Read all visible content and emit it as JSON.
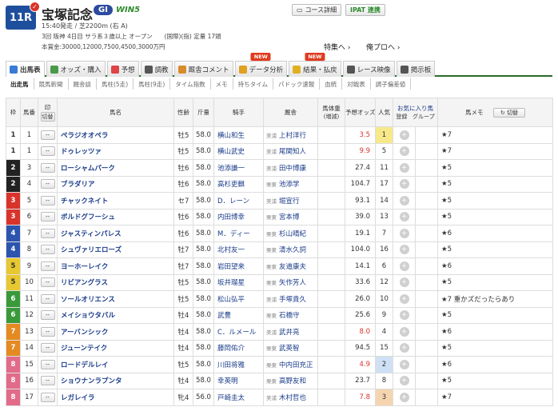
{
  "race": {
    "number": "11R",
    "name": "宝塚記念",
    "grade": "GI",
    "win5": "WIN5",
    "meta1": "15:40発走 / 芝2200m (右 A)",
    "meta2": "3回 阪神 4日目 サラ系３歳以上 オープン　　(国際)(指) 定量 17頭",
    "meta3": "本賞金:30000,12000,7500,4500,3000万円"
  },
  "header_buttons": {
    "course": "コース詳細",
    "ipat": "IPAT 連携"
  },
  "special_links": {
    "tokubetsu": "特集へ ›",
    "oreno": "俺プロへ ›"
  },
  "tabs": [
    {
      "label": "出馬表",
      "icon": "horse-icon",
      "color": "#3a7bd5",
      "new": ""
    },
    {
      "label": "オッズ・購入",
      "icon": "ticket-icon",
      "color": "#4a9a4a",
      "new": ""
    },
    {
      "label": "予想",
      "icon": "target-icon",
      "color": "#d44",
      "new": ""
    },
    {
      "label": "調教",
      "icon": "stopwatch-icon",
      "color": "#555",
      "new": ""
    },
    {
      "label": "厩舎コメント",
      "icon": "house-icon",
      "color": "#d88b2a",
      "new": ""
    },
    {
      "label": "データ分析",
      "icon": "chart-icon",
      "color": "#e0a020",
      "new": "NEW"
    },
    {
      "label": "結果・払戻",
      "icon": "trophy-icon",
      "color": "#e0b020",
      "new": "NEW"
    },
    {
      "label": "レース映像",
      "icon": "video-icon",
      "color": "#555",
      "new": ""
    },
    {
      "label": "掲示板",
      "icon": "board-icon",
      "color": "#555",
      "new": ""
    }
  ],
  "subtabs": [
    "出走馬",
    "競馬新聞",
    "厩舎談",
    "馬柱(5走)",
    "馬柱(9走)",
    "タイム指数",
    "メモ",
    "持ちタイム",
    "パドック速報",
    "血統",
    "対戦表",
    "調子偏差値"
  ],
  "columns": {
    "waku": "枠",
    "umaban": "馬番",
    "mark": "印",
    "mark_btn": "切替",
    "horse": "馬名",
    "sex_age": "性齢",
    "weight": "斤量",
    "jockey": "騎手",
    "trainer": "厩舎",
    "horse_weight": "馬体重",
    "horse_weight_sub": "(増減)",
    "odds": "予想オッズ",
    "popularity": "人気",
    "fav": "お気に入り馬",
    "fav_reg": "登録",
    "fav_group": "グループ",
    "memo": "馬メモ",
    "memo_btn": "切替"
  },
  "mark_placeholder": "--",
  "waku_colors": [
    "#ffffff",
    "#222222",
    "#d9342b",
    "#2c55b0",
    "#e8c830",
    "#3a9a3a",
    "#e58a20",
    "#e36b8a"
  ],
  "rows": [
    {
      "waku": 1,
      "num": "1",
      "name": "ペラジオオペラ",
      "sa": "牡5",
      "w": "58.0",
      "jockey": "横山和生",
      "area": "美浦",
      "trainer": "上村洋行",
      "odds": "3.5",
      "oddsHot": true,
      "pop": "1",
      "popColor": "#f7e88a",
      "memo": "★7"
    },
    {
      "waku": 1,
      "num": "1",
      "name": "ドゥレッツァ",
      "sa": "牡5",
      "w": "58.0",
      "jockey": "横山武史",
      "area": "美浦",
      "trainer": "尾関知人",
      "odds": "9.9",
      "oddsHot": true,
      "pop": "5",
      "popColor": "",
      "memo": "★7"
    },
    {
      "waku": 2,
      "num": "3",
      "name": "ローシャムパーク",
      "sa": "牡6",
      "w": "58.0",
      "jockey": "池添謙一",
      "area": "美浦",
      "trainer": "田中博康",
      "odds": "27.4",
      "oddsHot": false,
      "pop": "11",
      "popColor": "",
      "memo": "★5"
    },
    {
      "waku": 2,
      "num": "4",
      "name": "ブラダリア",
      "sa": "牡6",
      "w": "58.0",
      "jockey": "高杉吏麒",
      "area": "栗東",
      "trainer": "池添学",
      "odds": "104.7",
      "oddsHot": false,
      "pop": "17",
      "popColor": "",
      "memo": "★5"
    },
    {
      "waku": 3,
      "num": "5",
      "name": "チャックネイト",
      "sa": "セ7",
      "w": "58.0",
      "jockey": "D．レーン",
      "area": "美浦",
      "trainer": "堀宣行",
      "odds": "93.1",
      "oddsHot": false,
      "pop": "14",
      "popColor": "",
      "memo": "★5"
    },
    {
      "waku": 3,
      "num": "6",
      "name": "ボルドグフーシュ",
      "sa": "牡6",
      "w": "58.0",
      "jockey": "内田博幸",
      "area": "栗東",
      "trainer": "宮本博",
      "odds": "39.0",
      "oddsHot": false,
      "pop": "13",
      "popColor": "",
      "memo": "★5"
    },
    {
      "waku": 4,
      "num": "7",
      "name": "ジャスティンパレス",
      "sa": "牡6",
      "w": "58.0",
      "jockey": "M．ディー",
      "area": "栗東",
      "trainer": "杉山晴紀",
      "odds": "19.1",
      "oddsHot": false,
      "pop": "7",
      "popColor": "",
      "memo": "★6"
    },
    {
      "waku": 4,
      "num": "8",
      "name": "シュヴァリエローズ",
      "sa": "牡7",
      "w": "58.0",
      "jockey": "北村友一",
      "area": "栗東",
      "trainer": "清水久詞",
      "odds": "104.0",
      "oddsHot": false,
      "pop": "16",
      "popColor": "",
      "memo": "★5"
    },
    {
      "waku": 5,
      "num": "9",
      "name": "ヨーホーレイク",
      "sa": "牡7",
      "w": "58.0",
      "jockey": "岩田望来",
      "area": "栗東",
      "trainer": "友道康夫",
      "odds": "14.1",
      "oddsHot": false,
      "pop": "6",
      "popColor": "",
      "memo": "★6"
    },
    {
      "waku": 5,
      "num": "10",
      "name": "リビアングラス",
      "sa": "牡5",
      "w": "58.0",
      "jockey": "坂井瑠星",
      "area": "栗東",
      "trainer": "矢作芳人",
      "odds": "33.6",
      "oddsHot": false,
      "pop": "12",
      "popColor": "",
      "memo": "★5"
    },
    {
      "waku": 6,
      "num": "11",
      "name": "ソールオリエンス",
      "sa": "牡5",
      "w": "58.0",
      "jockey": "松山弘平",
      "area": "美浦",
      "trainer": "手塚貴久",
      "odds": "26.0",
      "oddsHot": false,
      "pop": "10",
      "popColor": "",
      "memo": "★7 重かズだったらあり"
    },
    {
      "waku": 6,
      "num": "12",
      "name": "メイショウタバル",
      "sa": "牡4",
      "w": "58.0",
      "jockey": "武豊",
      "area": "栗東",
      "trainer": "石橋守",
      "odds": "25.6",
      "oddsHot": false,
      "pop": "9",
      "popColor": "",
      "memo": "★5"
    },
    {
      "waku": 7,
      "num": "13",
      "name": "アーバンシック",
      "sa": "牡4",
      "w": "58.0",
      "jockey": "C．ルメール",
      "area": "美浦",
      "trainer": "武井亮",
      "odds": "8.0",
      "oddsHot": true,
      "pop": "4",
      "popColor": "",
      "memo": "★6"
    },
    {
      "waku": 7,
      "num": "14",
      "name": "ジューンテイク",
      "sa": "牡4",
      "w": "58.0",
      "jockey": "藤岡佑介",
      "area": "栗東",
      "trainer": "武英智",
      "odds": "94.5",
      "oddsHot": false,
      "pop": "15",
      "popColor": "",
      "memo": "★5"
    },
    {
      "waku": 8,
      "num": "15",
      "name": "ロードデルレイ",
      "sa": "牡5",
      "w": "58.0",
      "jockey": "川田将雅",
      "area": "栗東",
      "trainer": "中内田充正",
      "odds": "4.9",
      "oddsHot": true,
      "pop": "2",
      "popColor": "#cfe0f5",
      "memo": "★6"
    },
    {
      "waku": 8,
      "num": "16",
      "name": "ショウナンラプンタ",
      "sa": "牡4",
      "w": "58.0",
      "jockey": "幸英明",
      "area": "栗東",
      "trainer": "高野友和",
      "odds": "23.7",
      "oddsHot": false,
      "pop": "8",
      "popColor": "",
      "memo": "★5"
    },
    {
      "waku": 8,
      "num": "17",
      "name": "レガレイラ",
      "sa": "牝4",
      "w": "56.0",
      "jockey": "戸崎圭太",
      "area": "美浦",
      "trainer": "木村哲也",
      "odds": "7.8",
      "oddsHot": true,
      "pop": "3",
      "popColor": "#f5d5b0",
      "memo": "★7"
    }
  ]
}
